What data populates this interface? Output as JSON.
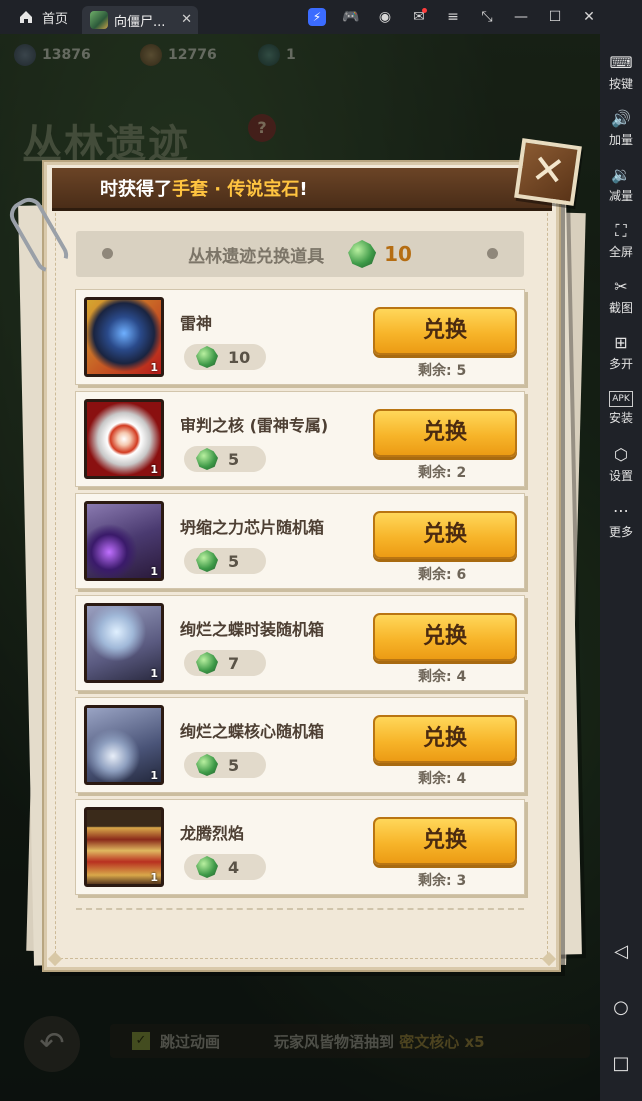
{
  "topbar": {
    "home_label": "首页",
    "app_tab_label": "向僵尸...",
    "close_tab": "✕"
  },
  "sidebar": {
    "items": [
      {
        "label": "按键",
        "icon": "keyboard-icon",
        "glyph": "⌨"
      },
      {
        "label": "加量",
        "icon": "volume-up-icon",
        "glyph": "🔊"
      },
      {
        "label": "减量",
        "icon": "volume-down-icon",
        "glyph": "🔉"
      },
      {
        "label": "全屏",
        "icon": "fullscreen-icon",
        "glyph": "⛶"
      },
      {
        "label": "截图",
        "icon": "scissors-icon",
        "glyph": "✂"
      },
      {
        "label": "多开",
        "icon": "multi-instance-icon",
        "glyph": "⊞"
      },
      {
        "label": "安装",
        "icon": "apk-install-icon",
        "glyph": "APK"
      },
      {
        "label": "设置",
        "icon": "settings-icon",
        "glyph": "⬡"
      },
      {
        "label": "更多",
        "icon": "more-icon",
        "glyph": "⋯"
      }
    ]
  },
  "resources": {
    "gold": "13876",
    "ticket": "12776",
    "gem": "1"
  },
  "background": {
    "title": "丛林遗迹",
    "help": "?",
    "skip_label": "跳过动画",
    "marquee_prefix": "玩家风皆物语抽到",
    "marquee_item": "密文核心 x5"
  },
  "dialog": {
    "banner_prefix": "时获得了",
    "banner_item": "手套 · 传说宝石",
    "banner_suffix": "!",
    "close_glyph": "✕",
    "section_title": "丛林遗迹兑换道具",
    "currency_count": "10",
    "redeem_label": "兑换",
    "items": [
      {
        "name": "雷神",
        "cost": "10",
        "remaining": "剩余:  5",
        "qty": "1"
      },
      {
        "name": "审判之核 (雷神专属)",
        "cost": "5",
        "remaining": "剩余:  2",
        "qty": "1"
      },
      {
        "name": "坍缩之力芯片随机箱",
        "cost": "5",
        "remaining": "剩余:  6",
        "qty": "1"
      },
      {
        "name": "绚烂之蝶时装随机箱",
        "cost": "7",
        "remaining": "剩余:  4",
        "qty": "1"
      },
      {
        "name": "绚烂之蝶核心随机箱",
        "cost": "5",
        "remaining": "剩余:  4",
        "qty": "1"
      },
      {
        "name": "龙腾烈焰",
        "cost": "4",
        "remaining": "剩余:  3",
        "qty": "1"
      }
    ]
  },
  "colors": {
    "accent_orange": "#f7b52a",
    "highlight_gold": "#ffc440",
    "paper": "#f1e8d8"
  }
}
